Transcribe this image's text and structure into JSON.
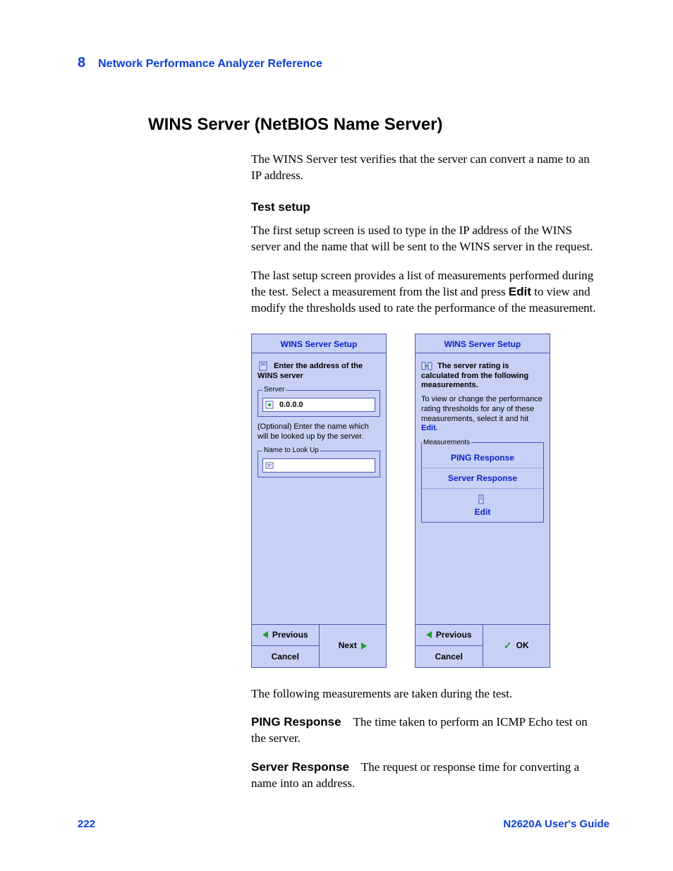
{
  "header": {
    "chapter_num": "8",
    "chapter_title": "Network Performance Analyzer Reference"
  },
  "section": {
    "title": "WINS Server (NetBIOS Name Server)",
    "intro": "The WINS Server test verifies that the server can convert a name to an IP address.",
    "subhead1": "Test setup",
    "para1": "The first setup screen is used to type in the IP address of the WINS server and the name that will be sent to the WINS server in the request.",
    "para2_pre": "The last setup screen provides a list of measurements performed during the test. Select a measurement from the list and press ",
    "para2_bold": "Edit",
    "para2_post": " to view and modify the thresholds used to rate the performance of the measurement.",
    "after_fig": "The following measurements are taken during the test.",
    "defs": [
      {
        "term": "PING Response",
        "desc": "The time taken to perform an ICMP Echo test on the server."
      },
      {
        "term": "Server Response",
        "desc": "The request or response time for converting a name into an address."
      }
    ]
  },
  "panel_left": {
    "title": "WINS Server Setup",
    "line1": "Enter the address of the WINS server",
    "group1_legend": "Server",
    "server_value": "0.0.0.0",
    "line2": "(Optional) Enter the name which will be looked up by the server.",
    "group2_legend": "Name to Look Up",
    "name_value": "",
    "btn_prev": "Previous",
    "btn_cancel": "Cancel",
    "btn_next": "Next"
  },
  "panel_right": {
    "title": "WINS Server Setup",
    "line1": "The server rating is calculated from the following measurements.",
    "line2_pre": "To view or change the performance rating thresholds for any of these measurements, select it and hit ",
    "line2_edit": "Edit.",
    "group_legend": "Measurements",
    "item1": "PING Response",
    "item2": "Server Response",
    "edit_label": "Edit",
    "btn_prev": "Previous",
    "btn_cancel": "Cancel",
    "btn_ok": "OK"
  },
  "footer": {
    "page_num": "222",
    "guide": "N2620A User's Guide"
  }
}
